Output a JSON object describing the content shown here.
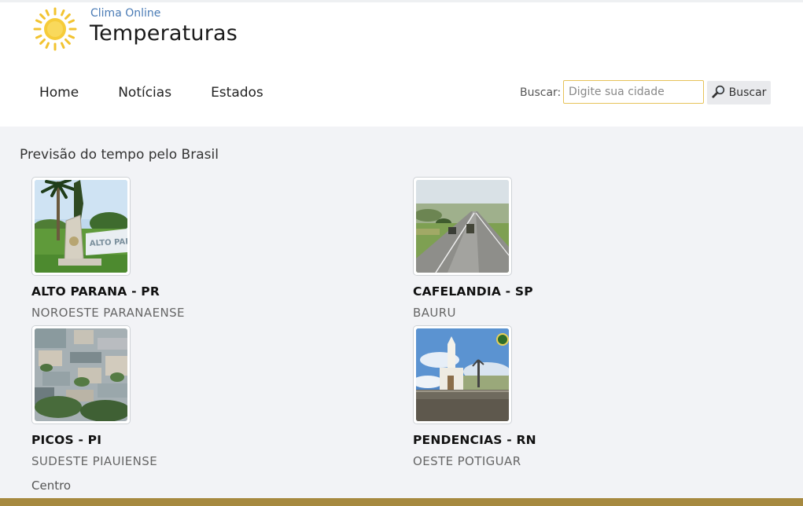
{
  "header": {
    "subtitle": "Clima Online",
    "title": "Temperaturas",
    "logo_icon": "sun-icon"
  },
  "nav": {
    "items": [
      {
        "label": "Home"
      },
      {
        "label": "Notícias"
      },
      {
        "label": "Estados"
      }
    ]
  },
  "search": {
    "label": "Buscar:",
    "placeholder": "Digite sua cidade",
    "value": "",
    "button_label": "Buscar",
    "button_icon": "magnifier-icon"
  },
  "main": {
    "section_title": "Previsão do tempo pelo Brasil",
    "cards": [
      {
        "city": "ALTO PARANA - PR",
        "region": "NOROESTE PARANAENSE"
      },
      {
        "city": "CAFELANDIA - SP",
        "region": "BAURU"
      },
      {
        "city": "PICOS - PI",
        "region": "SUDESTE PIAUIENSE"
      },
      {
        "city": "PENDENCIAS - RN",
        "region": "OESTE POTIGUAR"
      }
    ],
    "footer_link": "Centro"
  },
  "colors": {
    "accent_gold": "#a6893f",
    "link_blue": "#4a7bb5",
    "search_border": "#e6c35a"
  }
}
